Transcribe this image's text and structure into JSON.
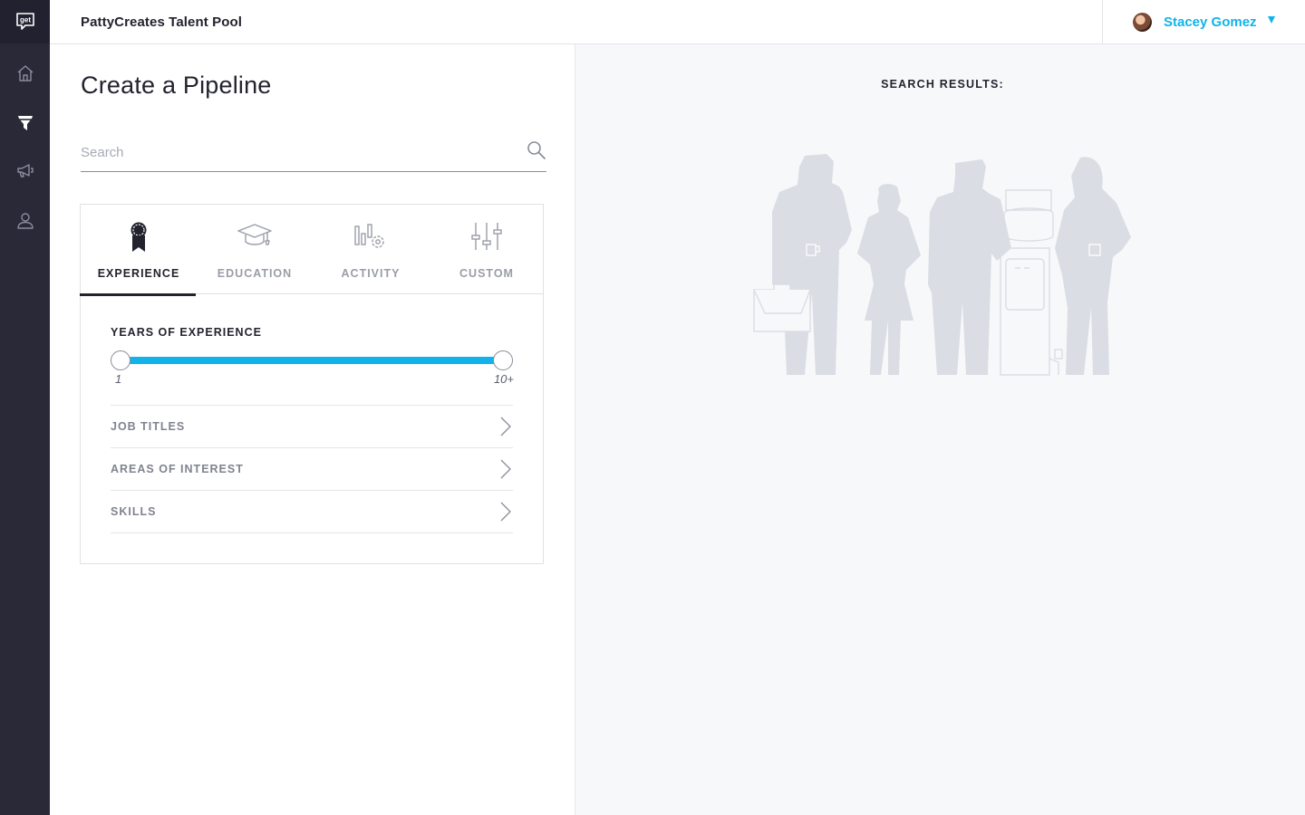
{
  "app": {
    "title": "PattyCreates Talent Pool",
    "logo_text": "get"
  },
  "user": {
    "name": "Stacey Gomez"
  },
  "nav": [
    {
      "name": "home",
      "icon": "home-icon"
    },
    {
      "name": "pipeline",
      "icon": "funnel-icon",
      "active": true
    },
    {
      "name": "campaigns",
      "icon": "megaphone-icon"
    },
    {
      "name": "profile",
      "icon": "user-icon"
    }
  ],
  "main": {
    "title": "Create a Pipeline",
    "search": {
      "placeholder": "Search",
      "value": ""
    },
    "tabs": [
      {
        "label": "EXPERIENCE",
        "icon": "ribbon-icon",
        "active": true
      },
      {
        "label": "EDUCATION",
        "icon": "graduation-cap-icon"
      },
      {
        "label": "ACTIVITY",
        "icon": "activity-chart-icon"
      },
      {
        "label": "CUSTOM",
        "icon": "sliders-icon"
      }
    ],
    "experience": {
      "years_label": "YEARS OF EXPERIENCE",
      "slider": {
        "min_label": "1",
        "max_label": "10+",
        "low_value": 1,
        "high_value": 10
      },
      "sections": [
        {
          "label": "JOB TITLES"
        },
        {
          "label": "AREAS OF INTEREST"
        },
        {
          "label": "SKILLS"
        }
      ]
    }
  },
  "results": {
    "label": "SEARCH RESULTS:",
    "empty_state_icon": "people-at-water-cooler-illustration"
  },
  "colors": {
    "accent": "#11b3ea",
    "rail": "#2a2938",
    "text": "#23232f",
    "muted": "#9a9da8"
  }
}
